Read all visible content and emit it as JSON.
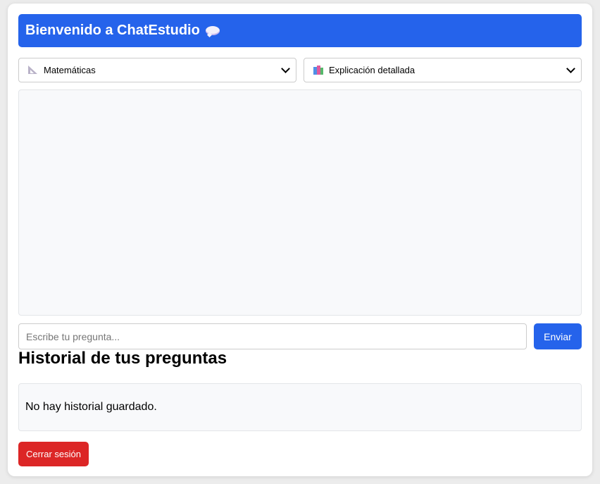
{
  "header": {
    "title": "Bienvenido a ChatEstudio",
    "icon": "speech-bubble-icon"
  },
  "selectors": {
    "subject": {
      "selected": "Matemáticas",
      "icon": "triangular-ruler-icon"
    },
    "mode": {
      "selected": "Explicación detallada",
      "icon": "books-icon"
    }
  },
  "chat": {
    "messages": []
  },
  "composer": {
    "placeholder": "Escribe tu pregunta...",
    "value": "",
    "send_label": "Enviar"
  },
  "history": {
    "title": "Historial de tus preguntas",
    "empty_text": "No hay historial guardado."
  },
  "footer": {
    "logout_label": "Cerrar sesión"
  },
  "colors": {
    "primary": "#2563eb",
    "danger": "#dc2626",
    "panel_bg": "#f8f9fb"
  }
}
